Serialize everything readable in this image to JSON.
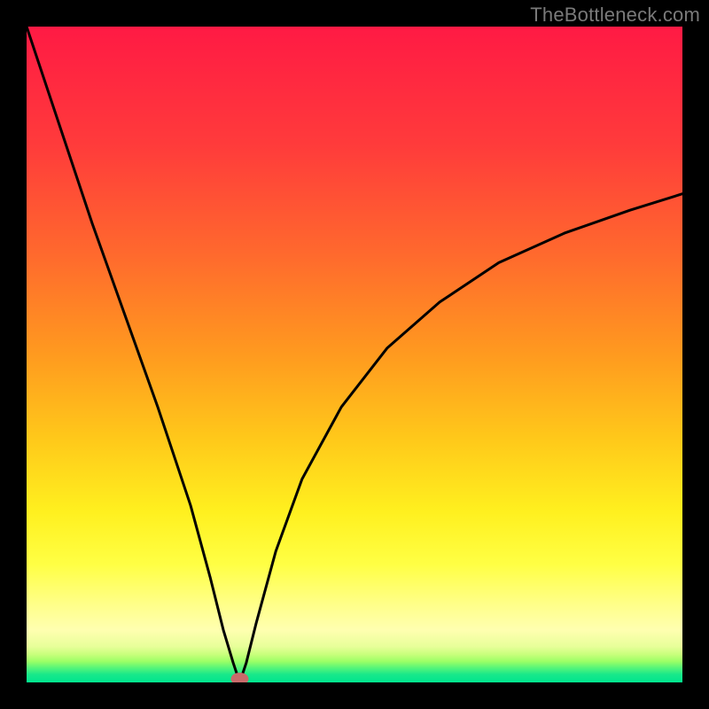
{
  "watermark": "TheBottleneck.com",
  "chart_data": {
    "type": "line",
    "title": "",
    "xlabel": "",
    "ylabel": "",
    "xlim": [
      0,
      100
    ],
    "ylim": [
      0,
      100
    ],
    "grid": false,
    "legend": false,
    "series": [
      {
        "name": "bottleneck-curve",
        "x": [
          0,
          5,
          10,
          15,
          20,
          25,
          28,
          30,
          31.5,
          32.5,
          33.5,
          35,
          38,
          42,
          48,
          55,
          63,
          72,
          82,
          92,
          100
        ],
        "y": [
          100,
          85,
          70,
          56,
          42,
          27,
          16,
          8,
          3,
          0,
          3,
          9,
          20,
          31,
          42,
          51,
          58,
          64,
          68.5,
          72,
          74.5
        ]
      }
    ],
    "marker": {
      "x": 32.5,
      "y": 0,
      "color": "#c86a6a",
      "name": "optimum-dot"
    },
    "gradient_stops": [
      {
        "offset": 0.0,
        "color": "#ff1a44"
      },
      {
        "offset": 0.18,
        "color": "#ff3b3b"
      },
      {
        "offset": 0.35,
        "color": "#ff6a2d"
      },
      {
        "offset": 0.5,
        "color": "#ff9a1f"
      },
      {
        "offset": 0.63,
        "color": "#ffc91a"
      },
      {
        "offset": 0.74,
        "color": "#fff01f"
      },
      {
        "offset": 0.82,
        "color": "#ffff44"
      },
      {
        "offset": 0.88,
        "color": "#ffff88"
      },
      {
        "offset": 0.92,
        "color": "#ffffb0"
      },
      {
        "offset": 0.945,
        "color": "#e8ff9a"
      },
      {
        "offset": 0.958,
        "color": "#c6ff7a"
      },
      {
        "offset": 0.968,
        "color": "#9bff66"
      },
      {
        "offset": 0.978,
        "color": "#55f57a"
      },
      {
        "offset": 0.988,
        "color": "#18e88a"
      },
      {
        "offset": 1.0,
        "color": "#00e58e"
      }
    ]
  }
}
